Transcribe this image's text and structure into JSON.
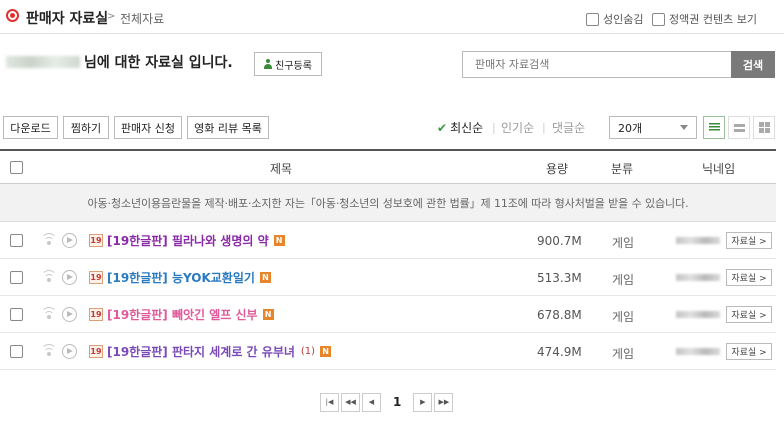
{
  "header": {
    "title": "판매자 자료실",
    "crumb_sep": ">",
    "crumb": "전체자료",
    "options": [
      {
        "label": "성인숨김",
        "checked": false
      },
      {
        "label": "정액권 컨텐츠 보기",
        "checked": false
      }
    ]
  },
  "seller": {
    "suffix": "님에 대한 자료실 입니다.",
    "friend_button": "친구등록"
  },
  "search": {
    "placeholder": "판매자 자료검색",
    "button": "검색"
  },
  "toolbar": {
    "buttons": [
      "다운로드",
      "찜하기",
      "판매자 신청",
      "영화 리뷰 목록"
    ],
    "sorts": [
      {
        "label": "최신순",
        "active": true
      },
      {
        "label": "인기순",
        "active": false
      },
      {
        "label": "댓글순",
        "active": false
      }
    ],
    "count_select": "20개"
  },
  "table": {
    "headers": {
      "title": "제목",
      "size": "용량",
      "category": "분류",
      "nickname": "닉네임"
    },
    "notice": "아동·청소년이용음란물을 제작·배포·소지한 자는「아동·청소년의 성보호에 관한 법률」제 11조에 따라 형사처벌을 받을 수 있습니다.",
    "rows": [
      {
        "age": "19",
        "title": "[19한글판] 필라나와 생명의 약",
        "title_color": "#8a2aa8",
        "new": "N",
        "comments": "",
        "size": "900.7M",
        "category": "게임",
        "seller_button": "자료실 >"
      },
      {
        "age": "19",
        "title": "[19한글판] 능YOK교환일기",
        "title_color": "#2a7ac0",
        "new": "N",
        "comments": "",
        "size": "513.3M",
        "category": "게임",
        "seller_button": "자료실 >"
      },
      {
        "age": "19",
        "title": "[19한글판] 빼앗긴 엘프 신부",
        "title_color": "#e05a9a",
        "new": "N",
        "comments": "",
        "size": "678.8M",
        "category": "게임",
        "seller_button": "자료실 >"
      },
      {
        "age": "19",
        "title": "[19한글판] 판타지 세계로 간 유부녀",
        "title_color": "#7a4ab8",
        "new": "N",
        "comments": "(1)",
        "size": "474.9M",
        "category": "게임",
        "seller_button": "자료실 >"
      }
    ]
  },
  "pagination": {
    "current": "1"
  }
}
